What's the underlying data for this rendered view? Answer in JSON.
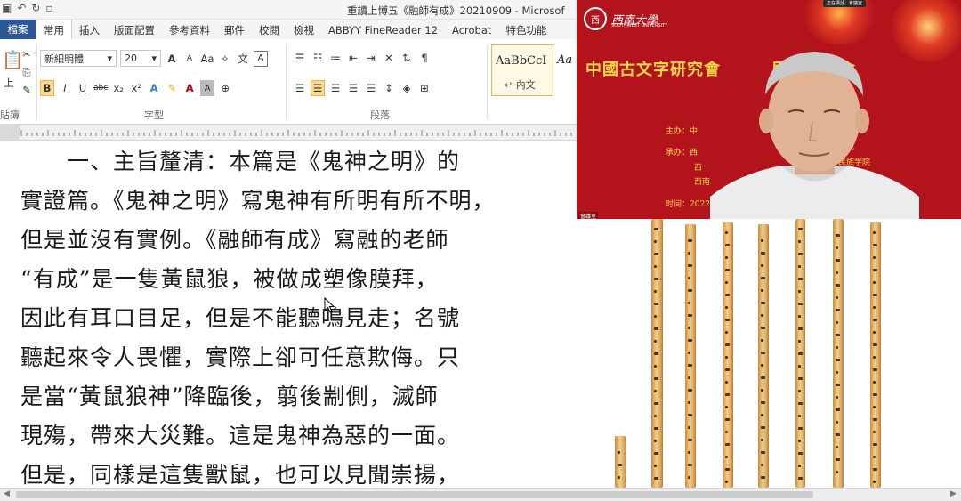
{
  "window": {
    "title": "重讀上博五《融師有成》20210909 - Microsof",
    "quick_access": [
      "檔",
      "↶",
      "↻",
      "▫"
    ],
    "file_tab": "檔案"
  },
  "ribbon": {
    "tabs": [
      "常用",
      "插入",
      "版面配置",
      "參考資料",
      "郵件",
      "校閱",
      "檢視",
      "ABBYY FineReader 12",
      "Acrobat",
      "特色功能"
    ],
    "active_tab": "常用",
    "clipboard_label": "貼簿",
    "font_name": "新細明體",
    "font_size": "20",
    "font_group_label": "字型",
    "paragraph_group_label": "段落",
    "style_sample": "AaBbCcI",
    "style_name": "↵ 內文",
    "style_next": "Aa",
    "font_buttons": [
      "B",
      "I",
      "U",
      "abc",
      "x₂",
      "x²"
    ],
    "grow_shrink": [
      "A",
      "A",
      "Aa"
    ]
  },
  "document": {
    "lines": [
      "　　一、主旨釐清：本篇是《鬼神之明》的",
      "實證篇。《鬼神之明》寫鬼神有所明有所不明，",
      "但是並沒有實例。《融師有成》寫融的老師",
      "“有成”是一隻黃鼠狼，被做成塑像膜拜，",
      "因此有耳口目足，但是不能聽鳴見走；名號",
      "聽起來令人畏懼，實際上卻可任意欺侮。只",
      "是當“黃鼠狼神”降臨後，翦後剬側，滅師",
      "現殤，帶來大災難。這是鬼神為惡的一面。",
      "但是，同樣是這隻獸鼠，也可以見聞崇揚，"
    ]
  },
  "video": {
    "university": "西南大學",
    "university_en": "SOUTHWEST UNIVERSITY",
    "banner": "中國古文字研究會　　　屆學術年會",
    "info_lines": [
      "主办：中",
      "承办：西",
      "西",
      "西南",
      "时间：2022"
    ],
    "info_right": [
      "学院",
      "民族学院"
    ],
    "speaker_label": "會議室",
    "badge": "正在講話：會議室"
  },
  "colors": {
    "video_bg": "#b3141c",
    "banner_text": "#f7d94a",
    "file_tab": "#2b5797",
    "slip_wood": "#e8b96c"
  }
}
